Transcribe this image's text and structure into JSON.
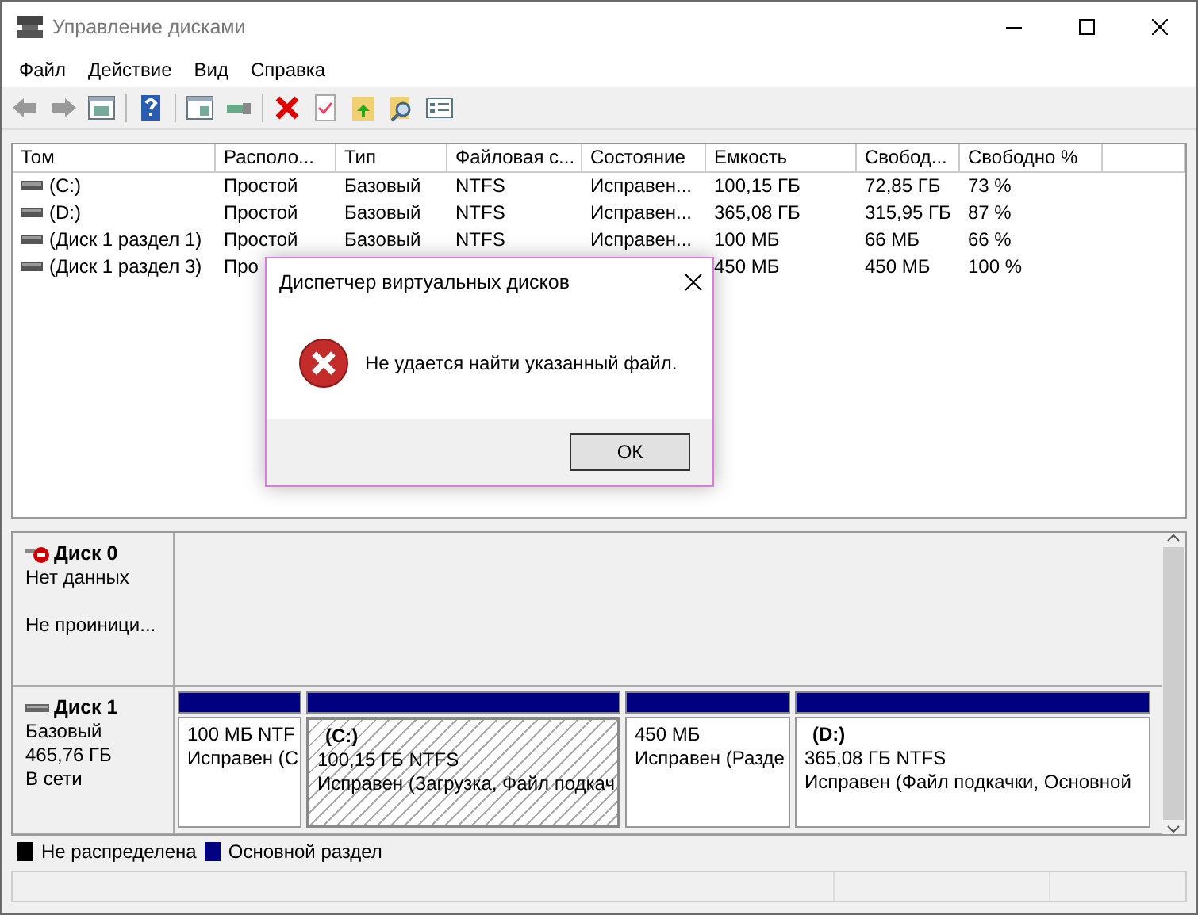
{
  "window": {
    "title": "Управление дисками"
  },
  "menu": [
    "Файл",
    "Действие",
    "Вид",
    "Справка"
  ],
  "table": {
    "columns": [
      "Том",
      "Располо...",
      "Тип",
      "Файловая с...",
      "Состояние",
      "Емкость",
      "Свобод...",
      "Свободно %"
    ],
    "rows": [
      {
        "cells": [
          "(C:)",
          "Простой",
          "Базовый",
          "NTFS",
          "Исправен...",
          "100,15 ГБ",
          "72,85 ГБ",
          "73 %"
        ]
      },
      {
        "cells": [
          "(D:)",
          "Простой",
          "Базовый",
          "NTFS",
          "Исправен...",
          "365,08 ГБ",
          "315,95 ГБ",
          "87 %"
        ]
      },
      {
        "cells": [
          "(Диск 1 раздел 1)",
          "Простой",
          "Базовый",
          "NTFS",
          "Исправен...",
          "100 МБ",
          "66 МБ",
          "66 %"
        ]
      },
      {
        "cells": [
          "(Диск 1 раздел 3)",
          "Про",
          null,
          null,
          null,
          "450 МБ",
          "450 МБ",
          "100 %"
        ]
      }
    ]
  },
  "dialog": {
    "title": "Диспетчер виртуальных дисков",
    "message": "Не удается найти указанный файл.",
    "button": "ОК"
  },
  "disks": [
    {
      "name": "Диск 0",
      "kind": "error",
      "lines": [
        "Нет данных",
        "Не проиници..."
      ]
    },
    {
      "name": "Диск 1",
      "kind": "online",
      "lines": [
        "Базовый",
        "465,76 ГБ",
        "В сети"
      ],
      "partitions": [
        {
          "size": "100 МБ NTF",
          "status": "Исправен (С",
          "selected": false
        },
        {
          "label": "(C:)",
          "size": "100,15 ГБ NTFS",
          "status": "Исправен (Загрузка, Файл подкач",
          "selected": true
        },
        {
          "size": "450 МБ",
          "status": "Исправен (Разде",
          "selected": false
        },
        {
          "label": "(D:)",
          "size": "365,08 ГБ NTFS",
          "status": "Исправен (Файл подкачки, Основной",
          "selected": false
        }
      ]
    }
  ],
  "legend": [
    {
      "label": "Не распределена",
      "color": "#000000"
    },
    {
      "label": "Основной раздел",
      "color": "#000080"
    }
  ]
}
